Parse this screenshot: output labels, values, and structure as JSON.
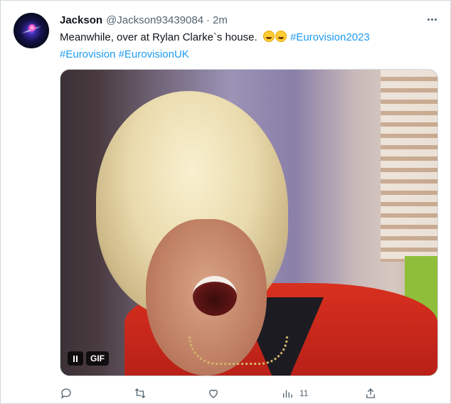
{
  "tweet": {
    "display_name": "Jackson",
    "handle": "@Jackson93439084",
    "separator": "·",
    "time": "2m",
    "text_part1": "Meanwhile, over at Rylan  Clarke`s house.",
    "hashtags_line1": [
      "#Eurovision2023"
    ],
    "hashtags_line2": [
      "#Eurovision",
      "#EurovisionUK"
    ],
    "emoji_count": 2,
    "emoji_name": "rolling-on-the-floor-laughing"
  },
  "media": {
    "type": "gif",
    "badge_label": "GIF",
    "description": ""
  },
  "actions": {
    "reply_count": "",
    "retweet_count": "",
    "like_count": "",
    "views_count": "11",
    "icons": [
      "reply-icon",
      "retweet-icon",
      "like-icon",
      "views-icon",
      "share-icon"
    ]
  },
  "colors": {
    "hashtag": "#1d9bf0",
    "secondary_text": "#536471",
    "border": "#cfd9de"
  }
}
